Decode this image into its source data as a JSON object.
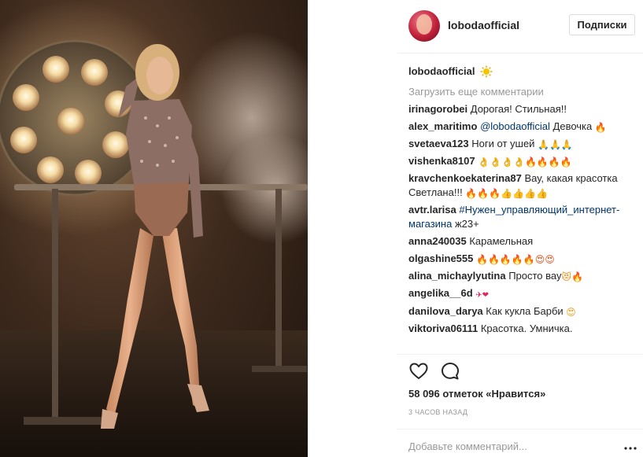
{
  "photo": {
    "alt_icon": "photo-image"
  },
  "header": {
    "username": "lobodaofficial",
    "follow_label": "Подписки"
  },
  "caption": {
    "username": "lobodaofficial",
    "badge_icon": "sun-icon"
  },
  "load_more": "Загрузить еще комментарии",
  "comments": [
    {
      "user": "irinagorobei",
      "text": "Дорогая! Стильная!!"
    },
    {
      "user": "alex_maritimo",
      "mention": "@lobodaofficial",
      "text": " Девочка ",
      "emoji": "🔥"
    },
    {
      "user": "svetaeva123",
      "text": "Ноги от ушей ",
      "emoji": "🙏🙏🙏"
    },
    {
      "user": "vishenka8107",
      "text": "",
      "emoji": "👌👌👌👌🔥🔥🔥🔥"
    },
    {
      "user": "kravchenkoekaterina87",
      "text": "Вау, какая красотка Светлана!!! ",
      "emoji": "🔥🔥🔥👍👍👍👍"
    },
    {
      "user": "avtr.larisa",
      "hashtag": "#Нужен_управляющий_интернет-магазина",
      "text": " ж23+"
    },
    {
      "user": "anna240035",
      "text": "Карамельная"
    },
    {
      "user": "olgashine555",
      "text": "",
      "emoji": "🔥🔥🔥🔥🔥😍😍"
    },
    {
      "user": "alina_michaylyutina",
      "text": "Просто вау",
      "emoji": "😻🔥"
    },
    {
      "user": "angelika__6d",
      "text": "",
      "emoji": "✈❤"
    },
    {
      "user": "danilova_darya",
      "text": "Как кукла Барби ",
      "emoji": "😍"
    },
    {
      "user": "viktoriva06111",
      "text": "Красотка. Умничка."
    }
  ],
  "actions": {
    "like_icon": "heart-icon",
    "comment_icon": "comment-icon",
    "likes_text": "58 096 отметок «Нравится»",
    "timestamp": "3 ЧАСОВ НАЗАД"
  },
  "add_comment": {
    "placeholder": "Добавьте комментарий...",
    "more_icon": "more-dots-icon"
  }
}
